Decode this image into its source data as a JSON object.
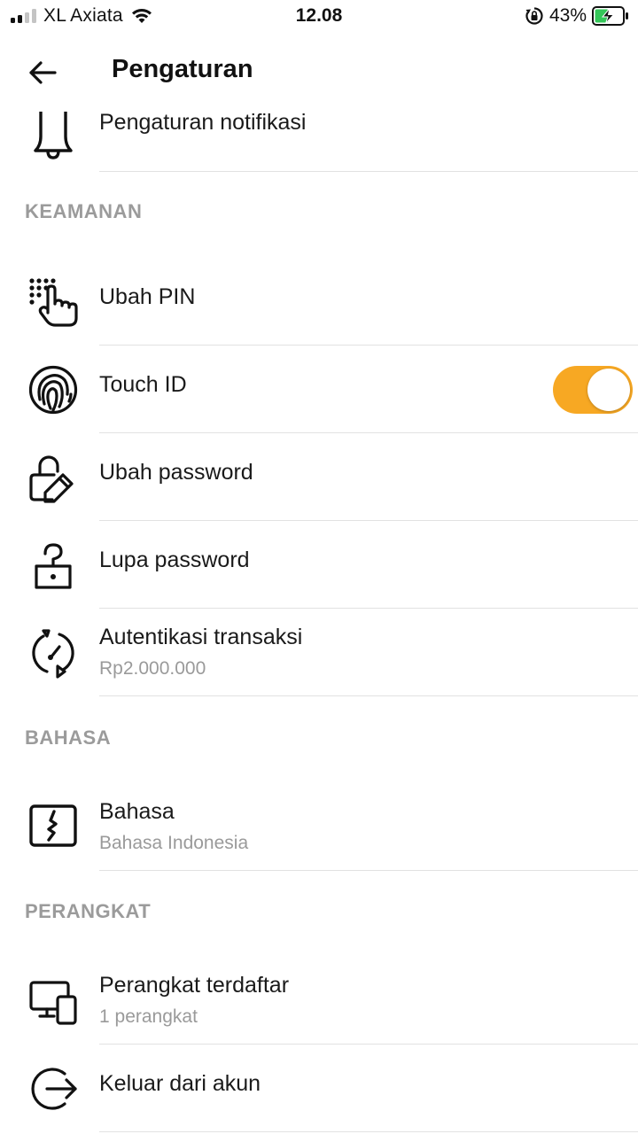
{
  "status_bar": {
    "carrier": "XL Axiata",
    "time": "12.08",
    "battery": "43%"
  },
  "header": {
    "title": "Pengaturan"
  },
  "items": {
    "notifikasi": {
      "label": "Pengaturan notifikasi",
      "icon": "bell-icon"
    },
    "ubah_pin": {
      "label": "Ubah PIN",
      "icon": "pin-keypad-icon"
    },
    "touch_id": {
      "label": "Touch ID",
      "icon": "fingerprint-icon",
      "enabled": true
    },
    "ubah_password": {
      "label": "Ubah password",
      "icon": "edit-lock-icon"
    },
    "lupa_password": {
      "label": "Lupa password",
      "icon": "question-lock-icon"
    },
    "autentikasi": {
      "label": "Autentikasi transaksi",
      "sub": "Rp2.000.000",
      "icon": "auth-cycle-icon"
    },
    "bahasa": {
      "label": "Bahasa",
      "sub": "Bahasa Indonesia",
      "icon": "language-icon"
    },
    "perangkat": {
      "label": "Perangkat terdaftar",
      "sub": "1 perangkat",
      "icon": "devices-icon"
    },
    "keluar": {
      "label": "Keluar dari akun",
      "icon": "logout-icon"
    }
  },
  "sections": {
    "keamanan": "KEAMANAN",
    "bahasa": "BAHASA",
    "perangkat": "PERANGKAT"
  },
  "colors": {
    "toggle_on": "#f7a823",
    "section_header": "#9b9b9b",
    "subtitle": "#9a9a9a"
  }
}
